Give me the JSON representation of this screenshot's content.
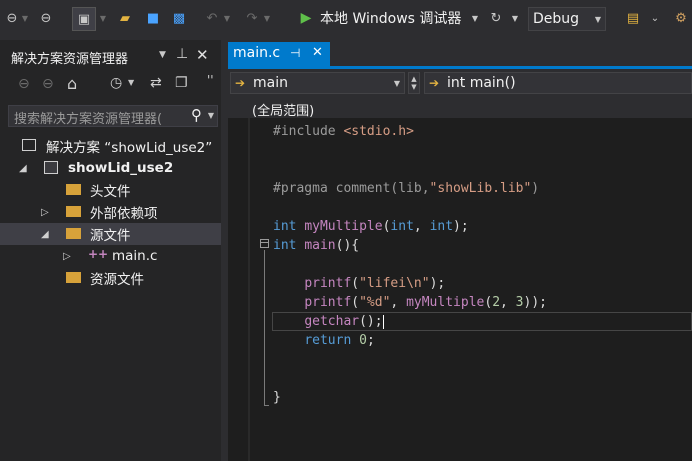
{
  "toolbar": {
    "run_label": "本地 Windows 调试器",
    "config_value": "Debug"
  },
  "solution_explorer": {
    "title": "解决方案资源管理器",
    "pin_icon": "pin-icon",
    "close_icon": "close-icon",
    "search_placeholder": "搜索解决方案资源管理器(",
    "tree": [
      {
        "label": "解决方案 “showLid_use2”",
        "level": 0,
        "expanded": true,
        "icon": "solution-icon"
      },
      {
        "label": "showLid_use2",
        "level": 1,
        "expanded": true,
        "bold": true,
        "icon": "project-icon"
      },
      {
        "label": "头文件",
        "level": 2,
        "expanded": null,
        "icon": "folder-icon"
      },
      {
        "label": "外部依赖项",
        "level": 2,
        "expanded": false,
        "icon": "dependencies-icon"
      },
      {
        "label": "源文件",
        "level": 2,
        "expanded": true,
        "selected": true,
        "icon": "folder-icon"
      },
      {
        "label": "main.c",
        "level": 3,
        "expanded": false,
        "icon": "c-file-icon"
      },
      {
        "label": "资源文件",
        "level": 2,
        "expanded": null,
        "icon": "folder-icon"
      }
    ]
  },
  "editor": {
    "tab_label": "main.c",
    "nav_left": "main",
    "nav_right": "int main()",
    "scope": "(全局范围)",
    "code_lines": [
      {
        "text": "#include <stdio.h>"
      },
      {
        "text": ""
      },
      {
        "text": ""
      },
      {
        "text": "#pragma comment(lib,\"showLib.lib\")"
      },
      {
        "text": ""
      },
      {
        "text": "int myMultiple(int, int);"
      },
      {
        "text": "int main(){"
      },
      {
        "text": ""
      },
      {
        "text": "    printf(\"lifei\\n\");"
      },
      {
        "text": "    printf(\"%d\", myMultiple(2, 3));"
      },
      {
        "text": "    getchar();"
      },
      {
        "text": "    return 0;"
      },
      {
        "text": ""
      },
      {
        "text": ""
      },
      {
        "text": "}"
      }
    ]
  },
  "colors": {
    "accent": "#007acc",
    "background": "#2d2d30",
    "editor_bg": "#1e1e1e",
    "keyword": "#569cd6",
    "function": "#c586c0",
    "string": "#d69d85"
  }
}
